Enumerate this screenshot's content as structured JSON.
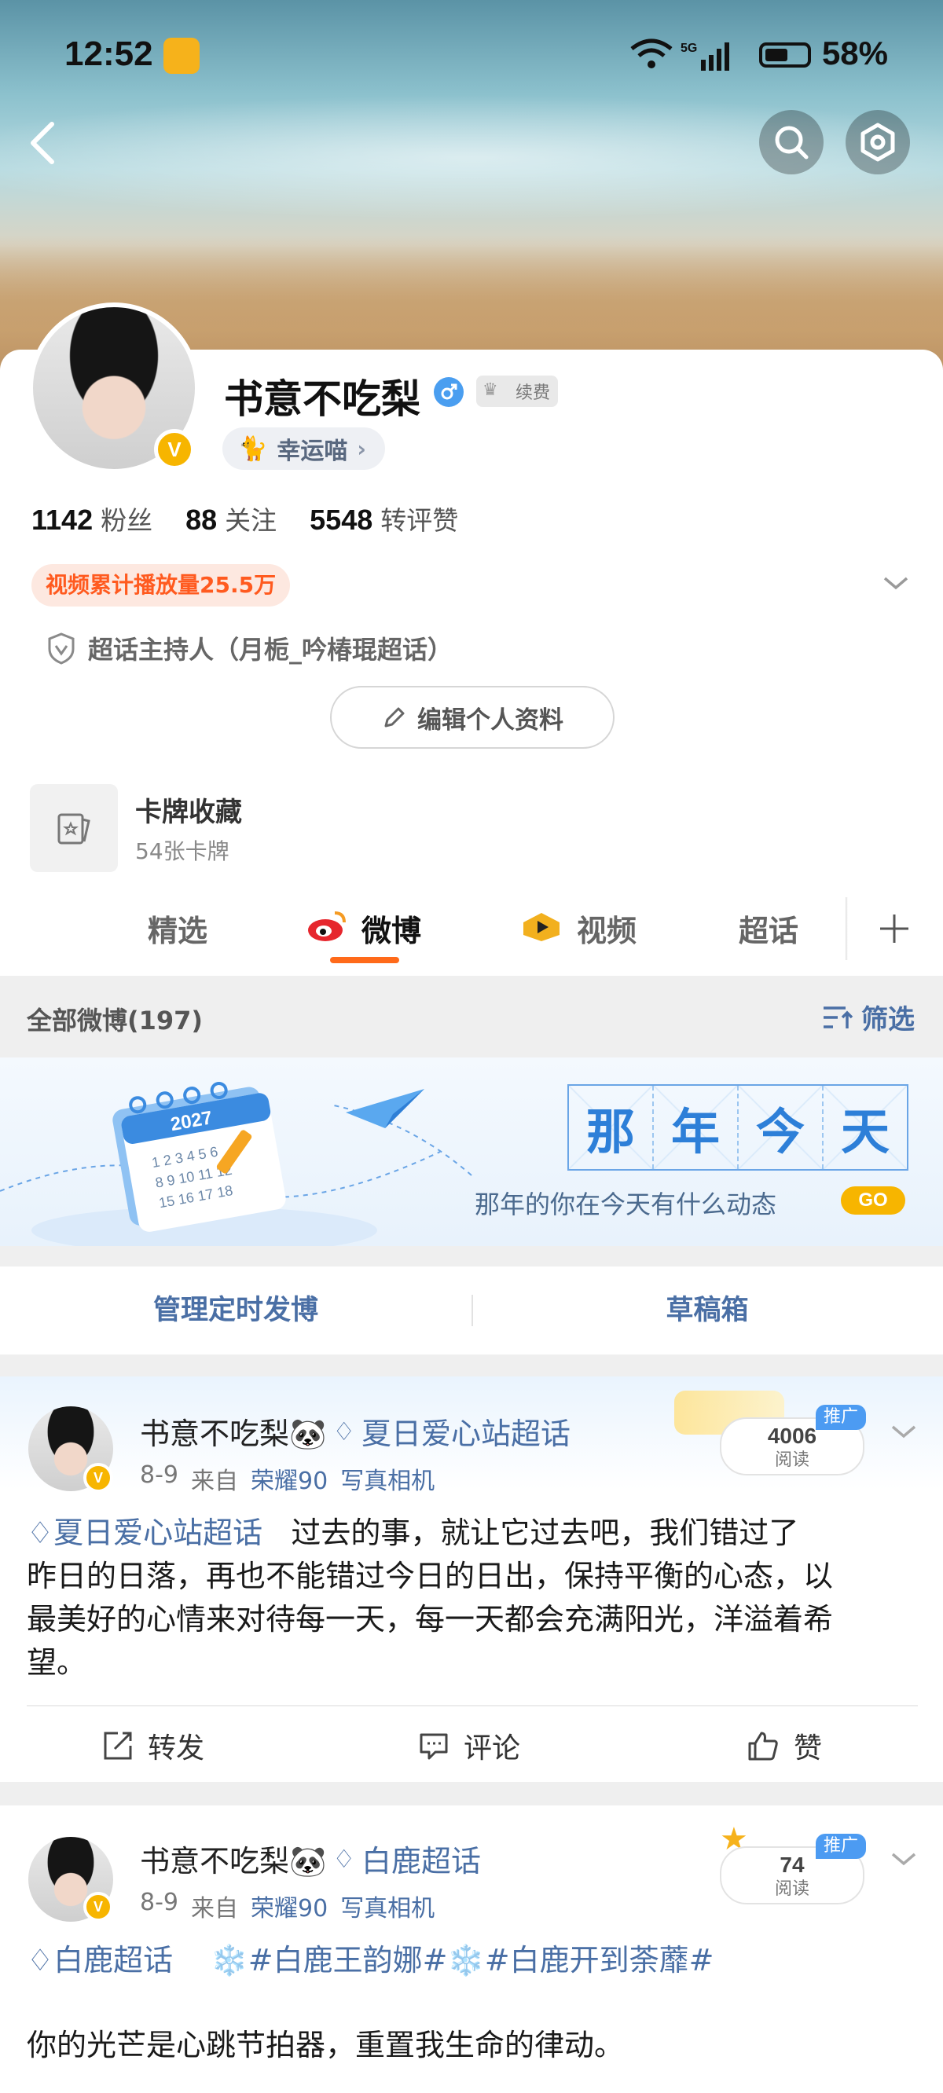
{
  "status_bar": {
    "time": "12:52",
    "network": "5G",
    "battery": "58%"
  },
  "profile": {
    "name": "书意不吃梨",
    "gender_icon": "male-icon",
    "vip_label": "续费",
    "lucky_tag": "幸运喵",
    "followers_num": "1142",
    "followers_label": "粉丝",
    "following_num": "88",
    "following_label": "关注",
    "engage_num": "5548",
    "engage_label": "转评赞",
    "video_tag": "视频累计播放量25.5万",
    "host_label": "超话主持人（月栀_吟椿琨超话）",
    "edit_button": "编辑个人资料"
  },
  "cards": {
    "title": "卡牌收藏",
    "subtitle": "54张卡牌"
  },
  "tabs": [
    {
      "label": "精选",
      "active": false
    },
    {
      "label": "微博",
      "active": true
    },
    {
      "label": "视频",
      "active": false
    },
    {
      "label": "超话",
      "active": false
    }
  ],
  "feed": {
    "all_label": "全部微博(197)",
    "filter_label": "筛选"
  },
  "banner": {
    "year": "2027",
    "chars": [
      "那",
      "年",
      "今",
      "天"
    ],
    "subtitle": "那年的你在今天有什么动态",
    "go": "GO"
  },
  "manage": {
    "scheduled": "管理定时发博",
    "drafts": "草稿箱"
  },
  "posts": [
    {
      "author": "书意不吃梨🐼",
      "topic": "夏日爱心站超话",
      "date": "8-9",
      "from_label": "来自",
      "device": "荣耀90",
      "camera": "写真相机",
      "reads": "4006",
      "reads_label": "阅读",
      "ad": "推广",
      "topic_link": "夏日爱心站超话",
      "lines": [
        "过去的事，就让它过去吧，我们错过了",
        "昨日的日落，再也不能错过今日的日出，保持平衡的心态，以",
        "最美好的心情来对待每一天，每一天都会充满阳光，洋溢着希",
        "望。"
      ],
      "repost": "转发",
      "comment": "评论",
      "like": "赞"
    },
    {
      "author": "书意不吃梨🐼",
      "topic": "白鹿超话",
      "date": "8-9",
      "from_label": "来自",
      "device": "荣耀90",
      "camera": "写真相机",
      "reads": "74",
      "reads_label": "阅读",
      "ad": "推广",
      "topic_link": "白鹿超话",
      "hashtags": "❄️#白鹿王韵娜#❄️#白鹿开到荼蘼#",
      "text": "你的光芒是心跳节拍器，重置我生命的律动。"
    }
  ],
  "colors": {
    "accent_orange": "#ff6a1a",
    "link_blue": "#4a6fa5",
    "vip_gold": "#f7b500"
  }
}
